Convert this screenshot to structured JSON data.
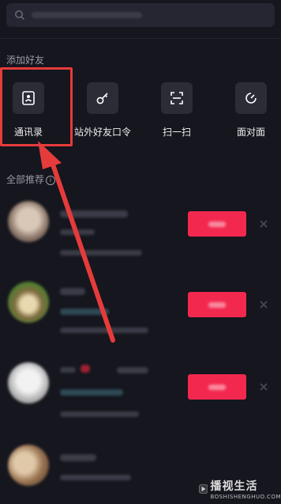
{
  "add_friends": {
    "title": "添加好友",
    "items": [
      {
        "label": "通讯录",
        "icon": "contacts-icon"
      },
      {
        "label": "站外好友口令",
        "icon": "key-icon"
      },
      {
        "label": "扫一扫",
        "icon": "scan-icon"
      },
      {
        "label": "面对面",
        "icon": "face-to-face-icon"
      }
    ]
  },
  "recommend": {
    "title": "全部推荐"
  },
  "colors": {
    "background": "#15161e",
    "follow_button": "#f3284f",
    "highlight": "#e63b3b"
  },
  "watermark": {
    "main": "播视生活",
    "sub": "BOSHISHENGHUO.COM"
  }
}
